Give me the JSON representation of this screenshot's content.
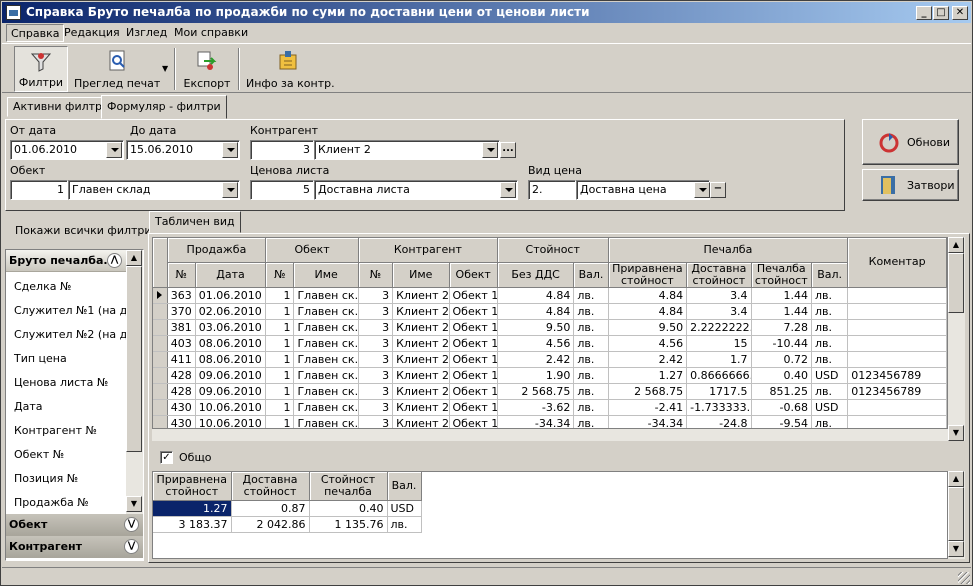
{
  "window": {
    "title": "Справка Бруто печалба по продажби по суми по доставни цени от ценови листи",
    "min": "_",
    "max": "□",
    "close": "✕"
  },
  "menu": [
    "Справка",
    "Редакция",
    "Изглед",
    "Мои справки"
  ],
  "toolbar": {
    "filters": "Филтри",
    "preview": "Преглед печат",
    "export": "Експорт",
    "info": "Инфо за контр."
  },
  "filter_tabs": [
    "Активни филтри",
    "Формуляр - филтри"
  ],
  "form": {
    "from_date_label": "От дата",
    "from_date": "01.06.2010",
    "to_date_label": "До дата",
    "to_date": "15.06.2010",
    "client_label": "Контрагент",
    "client_code": "3",
    "client_name": "Клиент 2",
    "object_label": "Обект",
    "object_code": "1",
    "object_name": "Главен склад",
    "pricelist_label": "Ценова листа",
    "pricelist_code": "5",
    "pricelist_name": "Доставна листа",
    "price_type_label": "Вид цена",
    "price_type_code": "2.",
    "price_type_name": "Доставна цена",
    "ellipsis": "...",
    "minus": "−"
  },
  "buttons": {
    "refresh": "Обнови",
    "close": "Затвори"
  },
  "show_all_filters": "Покажи всички филтри",
  "left_panel": {
    "group1": "Бруто печалба...",
    "items": [
      "Сделка №",
      "Служител №1 (на док.",
      "Служител №2 (на док.",
      "Тип цена",
      "Ценова листа №",
      "Дата",
      "Контрагент №",
      "Обект №",
      "Позиция №",
      "Продажба №"
    ],
    "group2": "Обект",
    "group3": "Контрагент"
  },
  "view_tab": "Табличен вид",
  "grid": {
    "groups": {
      "sale": "Продажба",
      "object": "Обект",
      "client": "Контрагент",
      "value": "Стойност",
      "profit": "Печалба",
      "comment": "Коментар"
    },
    "cols": {
      "num": "№",
      "date": "Дата",
      "name": "Име",
      "obj": "Обект",
      "no_vat": "Без ДДС",
      "cur": "Вал.",
      "eq_value": "Приравнена стойност",
      "del_value": "Доставна стойност",
      "profit_value": "Печалба стойност"
    },
    "rows": [
      {
        "sn": "363",
        "date": "01.06.2010",
        "on": "1",
        "oname": "Главен ск...",
        "cn": "3",
        "cname": "Клиент 2",
        "cobj": "Обект 1",
        "val": "4.84",
        "vcur": "лв.",
        "eq": "4.84",
        "del": "3.4",
        "pr": "1.44",
        "pcur": "лв.",
        "com": ""
      },
      {
        "sn": "370",
        "date": "02.06.2010",
        "on": "1",
        "oname": "Главен ск...",
        "cn": "3",
        "cname": "Клиент 2",
        "cobj": "Обект 1",
        "val": "4.84",
        "vcur": "лв.",
        "eq": "4.84",
        "del": "3.4",
        "pr": "1.44",
        "pcur": "лв.",
        "com": ""
      },
      {
        "sn": "381",
        "date": "03.06.2010",
        "on": "1",
        "oname": "Главен ск...",
        "cn": "3",
        "cname": "Клиент 2",
        "cobj": "Обект 1",
        "val": "9.50",
        "vcur": "лв.",
        "eq": "9.50",
        "del": "2.2222222...",
        "pr": "7.28",
        "pcur": "лв.",
        "com": ""
      },
      {
        "sn": "403",
        "date": "08.06.2010",
        "on": "1",
        "oname": "Главен ск...",
        "cn": "3",
        "cname": "Клиент 2",
        "cobj": "Обект 1",
        "val": "4.56",
        "vcur": "лв.",
        "eq": "4.56",
        "del": "15",
        "pr": "-10.44",
        "pcur": "лв.",
        "com": ""
      },
      {
        "sn": "411",
        "date": "08.06.2010",
        "on": "1",
        "oname": "Главен ск...",
        "cn": "3",
        "cname": "Клиент 2",
        "cobj": "Обект 1",
        "val": "2.42",
        "vcur": "лв.",
        "eq": "2.42",
        "del": "1.7",
        "pr": "0.72",
        "pcur": "лв.",
        "com": ""
      },
      {
        "sn": "428",
        "date": "09.06.2010",
        "on": "1",
        "oname": "Главен ск...",
        "cn": "3",
        "cname": "Клиент 2",
        "cobj": "Обект 1",
        "val": "1.90",
        "vcur": "лв.",
        "eq": "1.27",
        "del": "0.8666666...",
        "pr": "0.40",
        "pcur": "USD",
        "com": "0123456789"
      },
      {
        "sn": "428",
        "date": "09.06.2010",
        "on": "1",
        "oname": "Главен ск...",
        "cn": "3",
        "cname": "Клиент 2",
        "cobj": "Обект 1",
        "val": "2 568.75",
        "vcur": "лв.",
        "eq": "2 568.75",
        "del": "1717.5",
        "pr": "851.25",
        "pcur": "лв.",
        "com": "0123456789"
      },
      {
        "sn": "430",
        "date": "10.06.2010",
        "on": "1",
        "oname": "Главен ск...",
        "cn": "3",
        "cname": "Клиент 2",
        "cobj": "Обект 1",
        "val": "-3.62",
        "vcur": "лв.",
        "eq": "-2.41",
        "del": "-1.733333...",
        "pr": "-0.68",
        "pcur": "USD",
        "com": ""
      },
      {
        "sn": "430",
        "date": "10.06.2010",
        "on": "1",
        "oname": "Главен ск...",
        "cn": "3",
        "cname": "Клиент 2",
        "cobj": "Обект 1",
        "val": "-34.34",
        "vcur": "лв.",
        "eq": "-34.34",
        "del": "-24.8",
        "pr": "-9.54",
        "pcur": "лв.",
        "com": ""
      }
    ]
  },
  "totals": {
    "checkbox_label": "Общо",
    "checked": "✓",
    "cols": {
      "eq": "Приравнена стойност",
      "del": "Доставна стойност",
      "profit": "Стойност печалба",
      "cur": "Вал."
    },
    "rows": [
      {
        "eq": "1.27",
        "del": "0.87",
        "pr": "0.40",
        "cur": "USD"
      },
      {
        "eq": "3 183.37",
        "del": "2 042.86",
        "pr": "1 135.76",
        "cur": "лв."
      }
    ]
  }
}
